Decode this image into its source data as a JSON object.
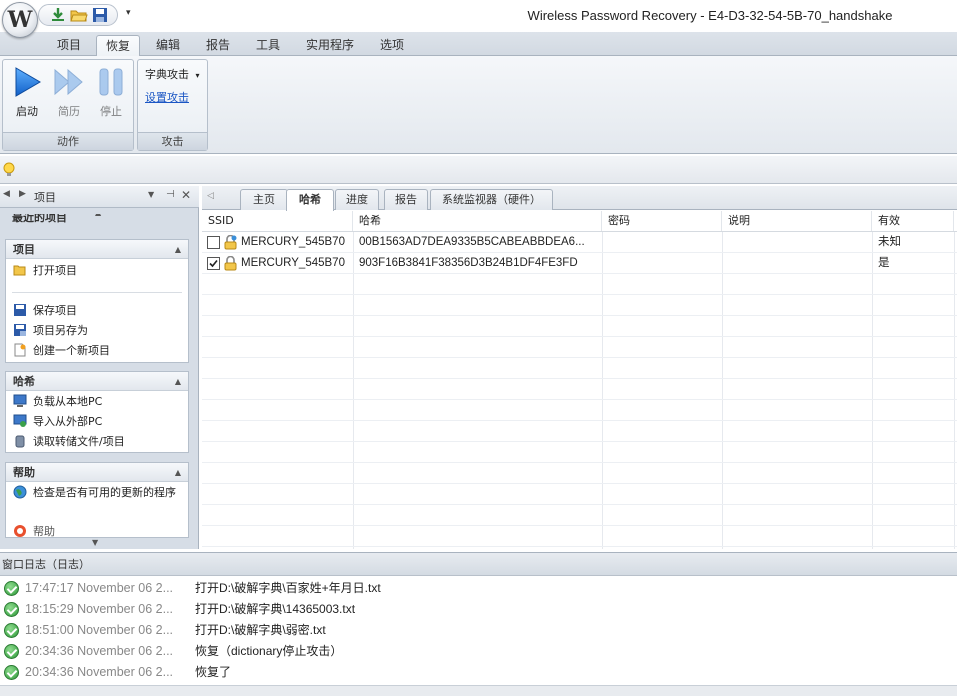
{
  "window": {
    "title": "Wireless Password Recovery - E4-D3-32-54-5B-70_handshake",
    "orb_letter": "W"
  },
  "quick_access": [
    "download-icon",
    "open-folder-icon",
    "save-icon"
  ],
  "ribbon": {
    "tabs": [
      "项目",
      "恢复",
      "编辑",
      "报告",
      "工具",
      "实用程序",
      "选项"
    ],
    "active_tab": "恢复",
    "groups": {
      "action": {
        "label": "动作",
        "buttons": [
          "启动",
          "简历",
          "停止"
        ]
      },
      "attack": {
        "label": "攻击",
        "dropdown": "字典攻击",
        "link": "设置攻击"
      }
    }
  },
  "left_panel": {
    "title": "项目",
    "recent_label": "最近的项目",
    "sections": {
      "project": {
        "title": "项目",
        "items": [
          "打开项目",
          "保存项目",
          "项目另存为",
          "创建一个新项目"
        ]
      },
      "hash": {
        "title": "哈希",
        "items": [
          "负载从本地PC",
          "导入从外部PC",
          "读取转储文件/项目"
        ]
      },
      "help": {
        "title": "帮助",
        "items": [
          "检查是否有可用的更新的程序",
          "帮助"
        ]
      }
    }
  },
  "doc_tabs": [
    "主页",
    "哈希",
    "进度",
    "报告",
    "系统监视器（硬件）"
  ],
  "active_doc_tab": "哈希",
  "grid": {
    "columns": [
      "SSID",
      "哈希",
      "密码",
      "说明",
      "有效"
    ],
    "rows": [
      {
        "checked": false,
        "ssid": "MERCURY_545B70",
        "hash": "00B1563AD7DEA9335B5CABEABBDEA6...",
        "password": "",
        "note": "",
        "valid": "未知"
      },
      {
        "checked": true,
        "ssid": "MERCURY_545B70",
        "hash": "903F16B3841F38356D3B24B1DF4FE3FD",
        "password": "",
        "note": "",
        "valid": "是"
      }
    ]
  },
  "log": {
    "title": "窗口日志（日志）",
    "entries": [
      {
        "time": "17:47:17 November 06 2...",
        "message": "打开D:\\破解字典\\百家姓+年月日.txt"
      },
      {
        "time": "18:15:29 November 06 2...",
        "message": "打开D:\\破解字典\\14365003.txt"
      },
      {
        "time": "18:51:00 November 06 2...",
        "message": "打开D:\\破解字典\\弱密.txt"
      },
      {
        "time": "20:34:36 November 06 2...",
        "message": "恢复（dictionary停止攻击）"
      },
      {
        "time": "20:34:36 November 06 2...",
        "message": "恢复了"
      }
    ]
  }
}
